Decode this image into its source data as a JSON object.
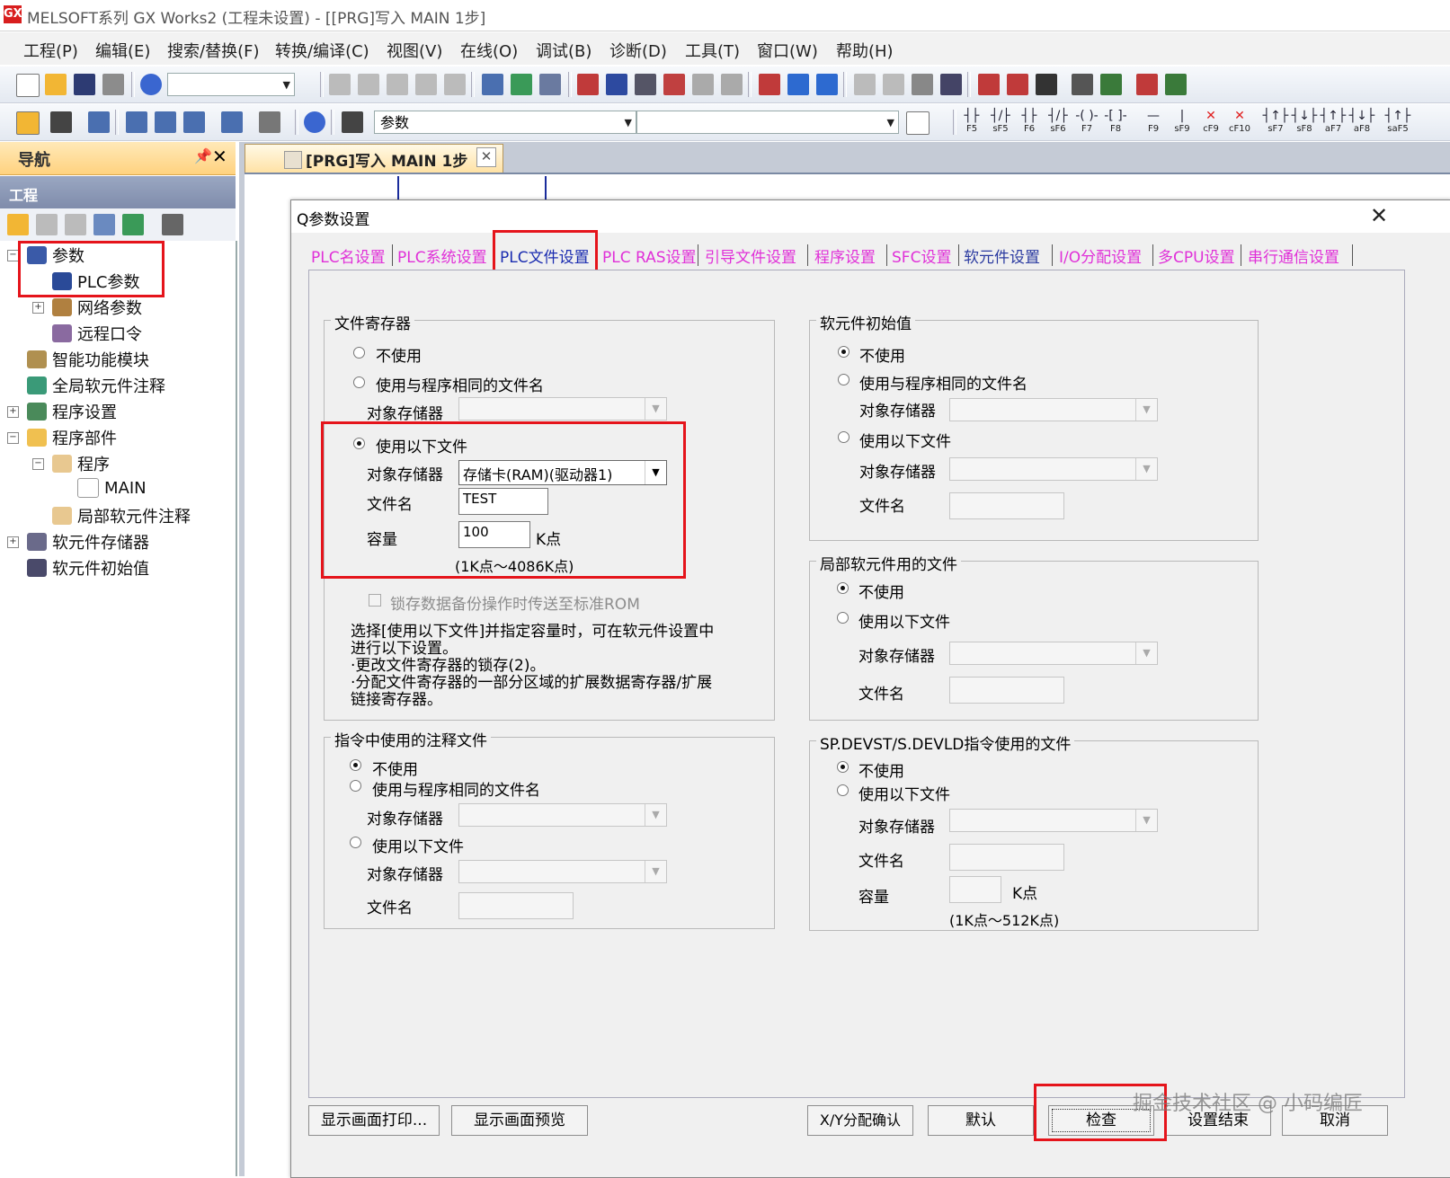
{
  "window": {
    "title": "MELSOFT系列 GX Works2 (工程未设置) - [[PRG]写入 MAIN 1步]",
    "app_icon": "GX"
  },
  "menu": [
    "工程(P)",
    "编辑(E)",
    "搜索/替换(F)",
    "转换/编译(C)",
    "视图(V)",
    "在线(O)",
    "调试(B)",
    "诊断(D)",
    "工具(T)",
    "窗口(W)",
    "帮助(H)"
  ],
  "toolbar2": {
    "combo_value": "参数"
  },
  "fkeys": [
    {
      "sym": "┤├",
      "label": "F5"
    },
    {
      "sym": "┤/├",
      "label": "sF5"
    },
    {
      "sym": "┤├",
      "label": "F6"
    },
    {
      "sym": "┤/├",
      "label": "sF6"
    },
    {
      "sym": "-( )-",
      "label": "F7"
    },
    {
      "sym": "-[ ]-",
      "label": "F8"
    },
    {
      "sym": "—",
      "label": "F9"
    },
    {
      "sym": "|",
      "label": "sF9"
    },
    {
      "sym": "✕",
      "label": "cF9"
    },
    {
      "sym": "✕",
      "label": "cF10"
    },
    {
      "sym": "┤↑├",
      "label": "sF7"
    },
    {
      "sym": "┤↓├",
      "label": "sF8"
    },
    {
      "sym": "┤↑├",
      "label": "aF7"
    },
    {
      "sym": "┤↓├",
      "label": "aF8"
    },
    {
      "sym": "┤↑├",
      "label": "saF5"
    }
  ],
  "nav": {
    "title": "导航",
    "pin": "📌",
    "close": "✕",
    "section": "工程",
    "tree": [
      {
        "label": "参数"
      },
      {
        "label": "PLC参数"
      },
      {
        "label": "网络参数"
      },
      {
        "label": "远程口令"
      },
      {
        "label": "智能功能模块"
      },
      {
        "label": "全局软元件注释"
      },
      {
        "label": "程序设置"
      },
      {
        "label": "程序部件"
      },
      {
        "label": "程序"
      },
      {
        "label": "MAIN"
      },
      {
        "label": "局部软元件注释"
      },
      {
        "label": "软元件存储器"
      },
      {
        "label": "软元件初始值"
      }
    ]
  },
  "doc_tab": {
    "label": "[PRG]写入 MAIN 1步",
    "close": "✕"
  },
  "dialog": {
    "title": "Q参数设置",
    "close": "✕",
    "tabs": [
      "PLC名设置",
      "PLC系统设置",
      "PLC文件设置",
      "PLC RAS设置",
      "引导文件设置",
      "程序设置",
      "SFC设置",
      "软元件设置",
      "I/O分配设置",
      "多CPU设置",
      "串行通信设置"
    ],
    "file_register": {
      "title": "文件寄存器",
      "opt1": "不使用",
      "opt2": "使用与程序相同的文件名",
      "mem_label1": "对象存储器",
      "opt3": "使用以下文件",
      "mem_label2": "对象存储器",
      "mem_value": "存储卡(RAM)(驱动器1)",
      "filename_label": "文件名",
      "filename_value": "TEST",
      "capacity_label": "容量",
      "capacity_value": "100",
      "capacity_unit": "K点",
      "capacity_range": "(1K点～4086K点)",
      "rom_check": "锁存数据备份操作时传送至标准ROM",
      "note1": "选择[使用以下文件]并指定容量时，可在软元件设置中",
      "note2": "进行以下设置。",
      "note3": "·更改文件寄存器的锁存(2)。",
      "note4": "·分配文件寄存器的一部分区域的扩展数据寄存器/扩展",
      "note5": "链接寄存器。"
    },
    "comment_file": {
      "title": "指令中使用的注释文件",
      "opt1": "不使用",
      "opt2": "使用与程序相同的文件名",
      "mem_label1": "对象存储器",
      "opt3": "使用以下文件",
      "mem_label2": "对象存储器",
      "filename_label": "文件名"
    },
    "device_init": {
      "title": "软元件初始值",
      "opt1": "不使用",
      "opt2": "使用与程序相同的文件名",
      "mem_label1": "对象存储器",
      "opt3": "使用以下文件",
      "mem_label2": "对象存储器",
      "filename_label": "文件名"
    },
    "local_device": {
      "title": "局部软元件用的文件",
      "opt1": "不使用",
      "opt2": "使用以下文件",
      "mem_label": "对象存储器",
      "filename_label": "文件名"
    },
    "devst": {
      "title": "SP.DEVST/S.DEVLD指令使用的文件",
      "opt1": "不使用",
      "opt2": "使用以下文件",
      "mem_label": "对象存储器",
      "filename_label": "文件名",
      "capacity_label": "容量",
      "capacity_unit": "K点",
      "capacity_range": "(1K点～512K点)"
    },
    "buttons": {
      "print": "显示画面打印...",
      "preview": "显示画面预览",
      "xy": "X/Y分配确认",
      "default": "默认",
      "check": "检查",
      "end": "设置结束",
      "cancel": "取消"
    }
  },
  "watermark": "掘金技术社区 @ 小码编匠",
  "colors": {
    "highlight": "#e5141b",
    "tab_text": "#e030d8",
    "nav_header": "#ffd27f"
  }
}
